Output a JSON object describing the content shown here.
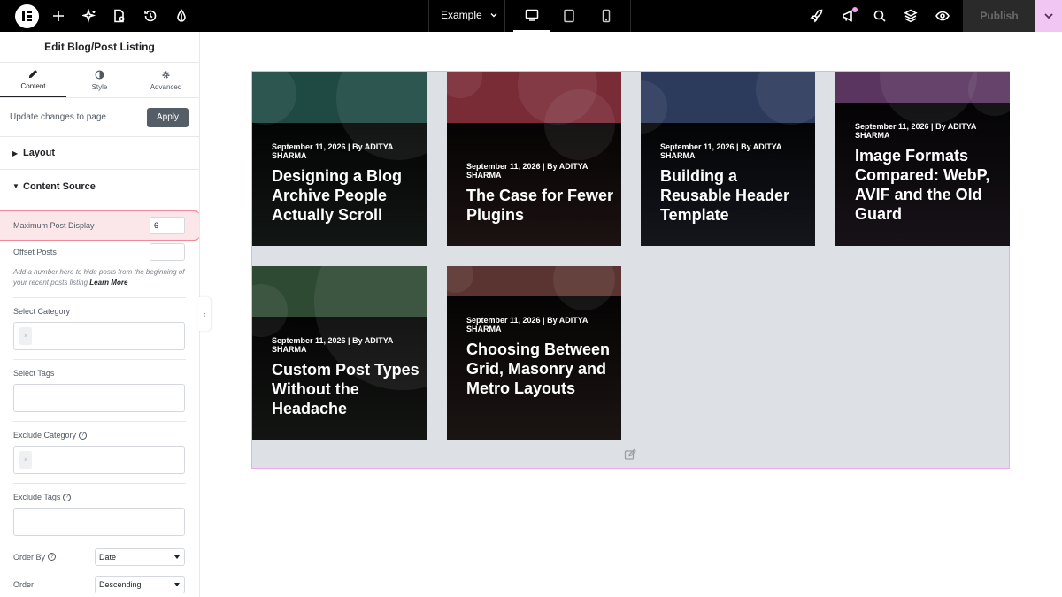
{
  "topbar": {
    "page_name": "Example",
    "publish_label": "Publish",
    "icons": [
      "elementor-logo-icon",
      "plus-icon",
      "sparkle-icon",
      "page-settings-icon",
      "history-icon",
      "site-style-icon",
      "rocket-icon",
      "announcement-icon",
      "search-icon",
      "layers-icon",
      "eye-icon"
    ],
    "devices": [
      "desktop-icon",
      "tablet-icon",
      "mobile-icon"
    ],
    "accent": "#f2c6f2"
  },
  "panel": {
    "title": "Edit Blog/Post Listing",
    "tabs": [
      {
        "label": "Content",
        "icon": "pencil-icon"
      },
      {
        "label": "Style",
        "icon": "contrast-icon"
      },
      {
        "label": "Advanced",
        "icon": "gear-icon"
      }
    ],
    "update_label": "Update changes to page",
    "apply_label": "Apply",
    "layout_label": "Layout",
    "content_source_label": "Content Source",
    "max_post_label": "Maximum Post Display",
    "max_post_value": "6",
    "offset_label": "Offset Posts",
    "offset_value": "",
    "hint_text": "Add a number here to hide posts from the beginning of your recent posts listing",
    "hint_link": "Learn More",
    "select_category_label": "Select Category",
    "select_tags_label": "Select Tags",
    "exclude_category_label": "Exclude Category",
    "exclude_tags_label": "Exclude Tags",
    "order_by_label": "Order By",
    "order_by_value": "Date",
    "order_label": "Order",
    "order_value": "Descending"
  },
  "posts": [
    {
      "meta": "September 11, 2026 | By ADITYA SHARMA",
      "title": "Designing a Blog Archive People Actually Scroll",
      "top_color": "#1f4a43",
      "bottom_color": "#121614"
    },
    {
      "meta": "September 11, 2026 | By ADITYA SHARMA",
      "title": "The Case for Fewer Plugins",
      "top_color": "#7a2c36",
      "bottom_color": "#1c1212"
    },
    {
      "meta": "September 11, 2026 | By ADITYA SHARMA",
      "title": "Building a Reusable Header Template",
      "top_color": "#2c3a5c",
      "bottom_color": "#14161d"
    },
    {
      "meta": "September 11, 2026 | By ADITYA SHARMA",
      "title": "Image Formats Compared: WebP, AVIF and the Old Guard",
      "top_color": "#5a3560",
      "bottom_color": "#171218"
    },
    {
      "meta": "September 11, 2026 | By ADITYA SHARMA",
      "title": "Custom Post Types Without the Headache",
      "top_color": "#2e4a33",
      "bottom_color": "#131513"
    },
    {
      "meta": "September 11, 2026 | By ADITYA SHARMA",
      "title": "Choosing Between Grid, Masonry and Metro Layouts",
      "top_color": "#5a3430",
      "bottom_color": "#1b1413"
    }
  ]
}
